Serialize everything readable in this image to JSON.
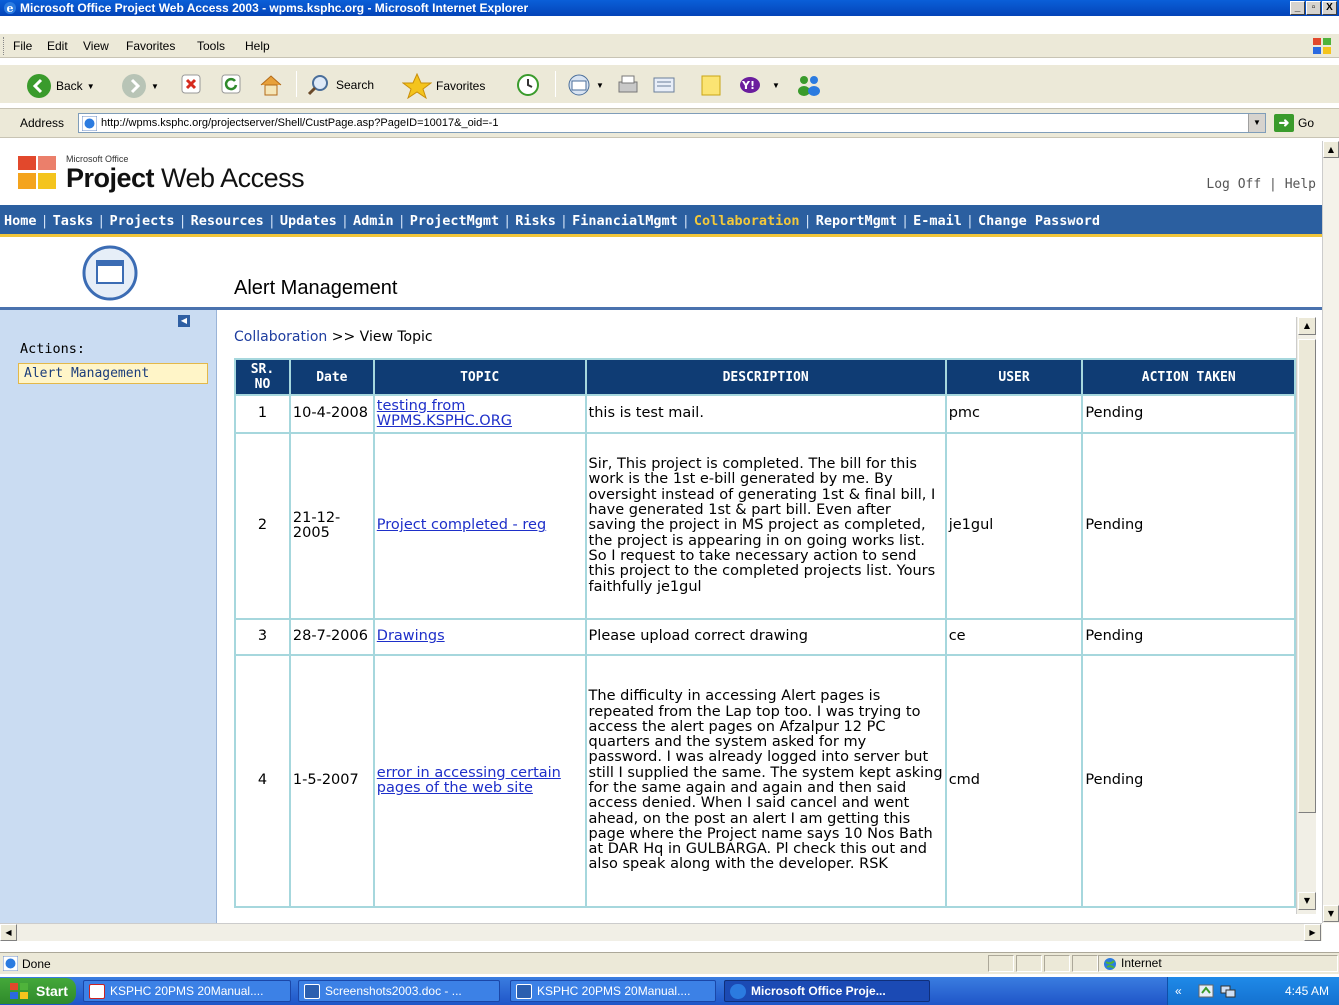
{
  "window": {
    "title": "Microsoft Office Project Web Access 2003 - wpms.ksphc.org - Microsoft Internet Explorer",
    "minimize": "_",
    "maximize": "▫",
    "close": "X"
  },
  "menu": {
    "file": "File",
    "edit": "Edit",
    "view": "View",
    "favorites": "Favorites",
    "tools": "Tools",
    "help": "Help"
  },
  "toolbar": {
    "back": "Back",
    "search": "Search",
    "favorites": "Favorites"
  },
  "address": {
    "label": "Address",
    "url": "http://wpms.ksphc.org/projectserver/Shell/CustPage.asp?PageID=10017&_oid=-1",
    "go": "Go"
  },
  "pwa": {
    "logo_small": "Microsoft Office",
    "logo_bold": "Project",
    "logo_rest": " Web Access",
    "log_off": "Log Off",
    "separator": " | ",
    "help": "Help"
  },
  "nav": {
    "items": [
      "Home",
      "Tasks",
      "Projects",
      "Resources",
      "Updates",
      "Admin",
      "ProjectMgmt",
      "Risks",
      "FinancialMgmt",
      "Collaboration",
      "ReportMgmt",
      "E-mail",
      "Change Password"
    ],
    "separator": "|",
    "active": "Collaboration"
  },
  "page": {
    "title": "Alert Management",
    "actions_label": "Actions:",
    "sidebar_item": "Alert Management",
    "breadcrumb_link": "Collaboration",
    "breadcrumb_rest": " >> View Topic"
  },
  "table": {
    "headers": {
      "sr_no": "SR. NO",
      "date": "Date",
      "topic": "TOPIC",
      "description": "DESCRIPTION",
      "user": "USER",
      "action": "ACTION TAKEN"
    },
    "rows": [
      {
        "sr": "1",
        "date": "10-4-2008",
        "topic": "testing from WPMS.KSPHC.ORG",
        "description": "this is test mail.",
        "user": "pmc",
        "action": "Pending"
      },
      {
        "sr": "2",
        "date": "21-12-2005",
        "topic": "Project completed - reg",
        "description": "Sir, This project is completed. The bill for this work is the 1st e-bill generated by me. By oversight instead of generating 1st & final bill, I have generated 1st & part bill. Even after saving the project in MS project as completed, the project is appearing in on going works list. So I request to take necessary action to send this project to the completed projects list. Yours faithfully je1gul",
        "user": "je1gul",
        "action": "Pending"
      },
      {
        "sr": "3",
        "date": "28-7-2006",
        "topic": "Drawings",
        "description": "Please upload correct drawing",
        "user": "ce",
        "action": "Pending"
      },
      {
        "sr": "4",
        "date": "1-5-2007",
        "topic": "error in accessing certain pages of the web site",
        "description": "The difficulty in accessing Alert pages is repeated from the Lap top too. I was trying to access the alert pages on Afzalpur 12 PC quarters and the system asked for my password. I was already logged into server but still I supplied the same. The system kept asking for the same again and again and then said access denied. When I said cancel and went ahead, on the post an alert I am getting this page where the Project name says 10 Nos Bath at DAR Hq in GULBARGA. Pl check this out and also speak along with the developer. RSK",
        "user": "cmd",
        "action": "Pending"
      }
    ]
  },
  "status": {
    "left": "Done",
    "zone": "Internet"
  },
  "taskbar": {
    "start": "Start",
    "tasks": [
      {
        "label": "KSPHC 20PMS 20Manual....",
        "icon": "pdf-icon"
      },
      {
        "label": "Screenshots2003.doc - ...",
        "icon": "word-icon"
      },
      {
        "label": "KSPHC 20PMS 20Manual....",
        "icon": "word-icon"
      },
      {
        "label": "Microsoft Office Proje...",
        "icon": "ie-icon"
      }
    ],
    "tray_chevron": "«",
    "time": "4:45 AM"
  },
  "colors": {
    "nav_bg": "#2b5fa0",
    "nav_active": "#f3c83a",
    "table_header": "#0f3c74",
    "table_border": "#a6d7dd",
    "sidebar_bg": "#cadcf2",
    "link": "#1e2fc9"
  }
}
